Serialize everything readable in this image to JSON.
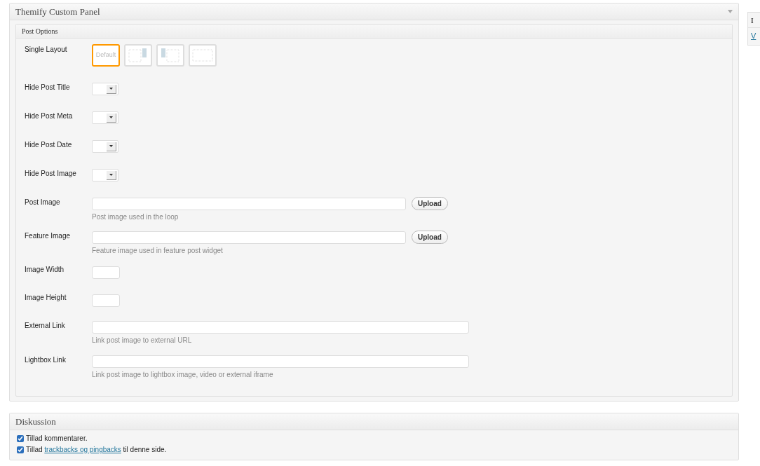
{
  "panel": {
    "title": "Themify Custom Panel",
    "section": {
      "title": "Post Options",
      "fields": [
        {
          "kind": "layout",
          "label": "Single Layout",
          "options": [
            {
              "kind": "default",
              "text": "Default",
              "selected": true
            },
            {
              "kind": "sidebar-right",
              "selected": false
            },
            {
              "kind": "sidebar-left",
              "selected": false
            },
            {
              "kind": "full",
              "selected": false
            }
          ]
        },
        {
          "kind": "select",
          "label": "Hide Post Title"
        },
        {
          "kind": "select",
          "label": "Hide Post Meta"
        },
        {
          "kind": "select",
          "label": "Hide Post Date"
        },
        {
          "kind": "select",
          "label": "Hide Post Image"
        },
        {
          "kind": "upload",
          "label": "Post Image",
          "button": "Upload",
          "help": "Post image used in the loop"
        },
        {
          "kind": "upload",
          "label": "Feature Image",
          "button": "Upload",
          "help": "Feature image used in feature post widget"
        },
        {
          "kind": "small",
          "label": "Image Width"
        },
        {
          "kind": "small",
          "label": "Image Height"
        },
        {
          "kind": "wide",
          "label": "External Link",
          "help": "Link post image to external URL"
        },
        {
          "kind": "wide",
          "label": "Lightbox Link",
          "help": "Link post image to lightbox image, video or external iframe"
        }
      ]
    }
  },
  "discussion": {
    "title": "Diskussion",
    "items": [
      {
        "checked": true,
        "text": "Tillad kommentarer."
      },
      {
        "checked": true,
        "text": "Tillad ",
        "link": "trackbacks og pingbacks",
        "text_after": " til denne side."
      }
    ]
  },
  "side_box": {
    "title": "I",
    "link": "V"
  }
}
